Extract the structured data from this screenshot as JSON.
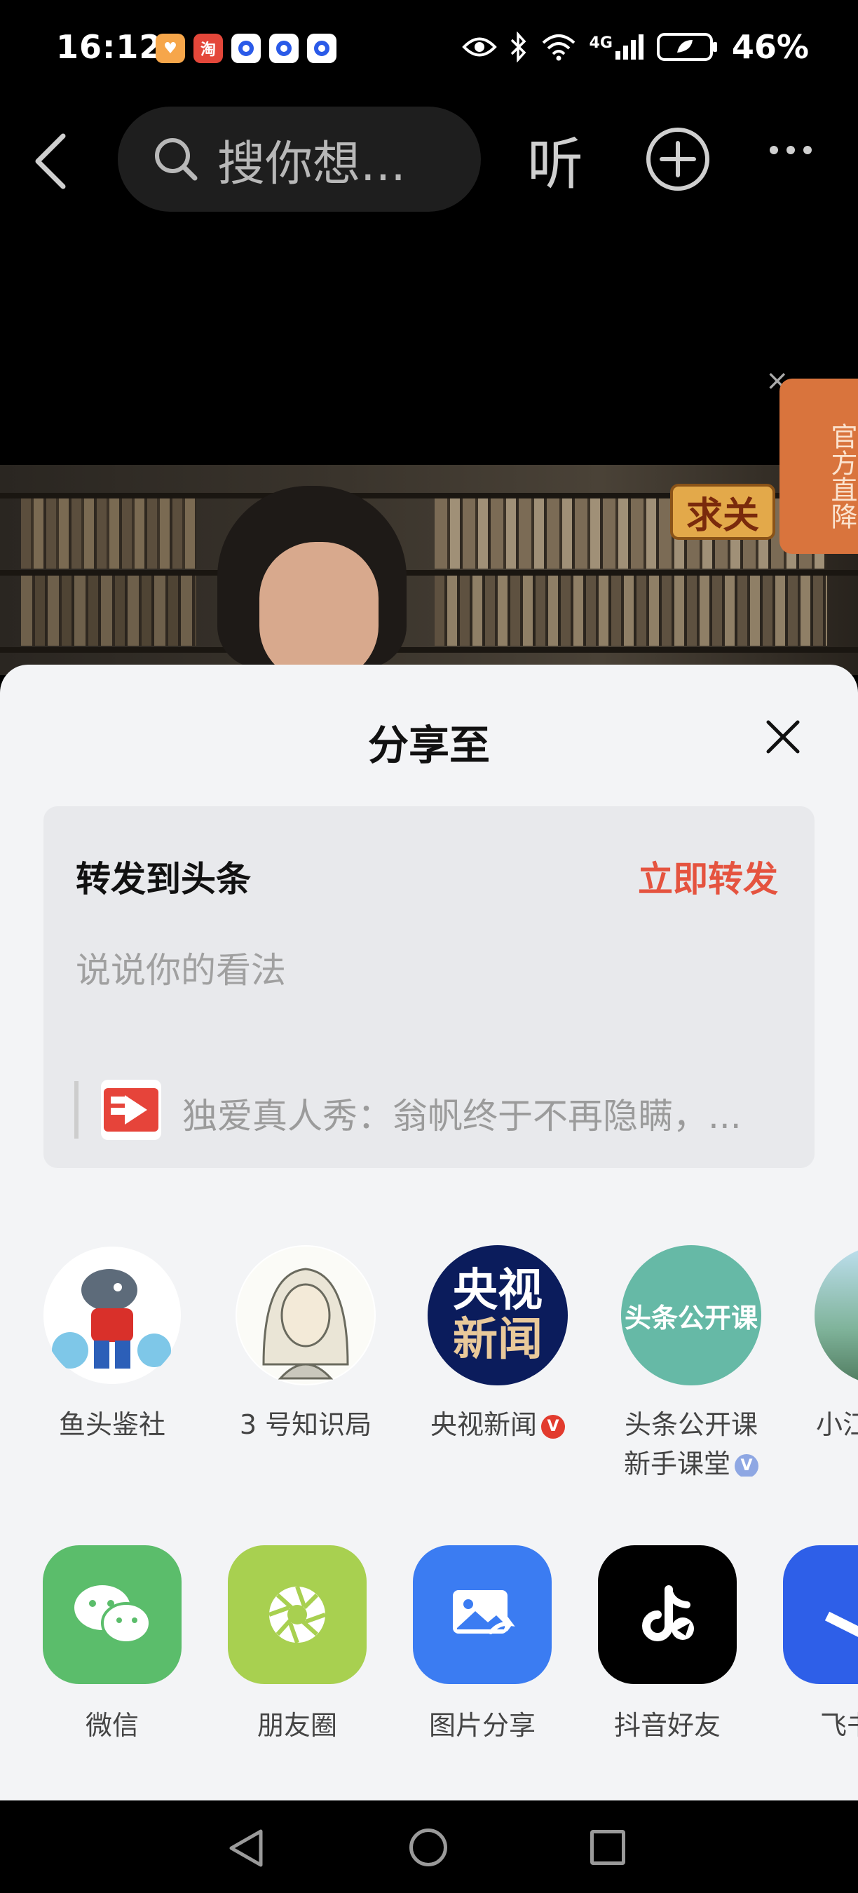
{
  "status_bar": {
    "time": "16:12",
    "network": "4G",
    "battery": "46%"
  },
  "top_nav": {
    "search_placeholder": "搜你想...",
    "listen_label": "听"
  },
  "promo": {
    "tag_text": "官方直降",
    "follow_sign": "求关"
  },
  "share_sheet": {
    "title": "分享至",
    "repost": {
      "title": "转发到头条",
      "action": "立即转发",
      "input_placeholder": "说说你的看法",
      "quote_text": "独爱真人秀：翁帆终于不再隐瞒，..."
    },
    "contacts": [
      {
        "name": "鱼头鉴社"
      },
      {
        "name": "3 号知识局"
      },
      {
        "name": "央视新闻",
        "avatar_text_1": "央视",
        "avatar_text_2": "新闻"
      },
      {
        "name_line1": "头条公开课",
        "name_line2": "新手课堂",
        "avatar_text": "头条公开课"
      },
      {
        "name": "小江"
      }
    ],
    "apps": [
      {
        "label": "微信",
        "color": "#5bbd6b"
      },
      {
        "label": "朋友圈",
        "color": "#a8d050"
      },
      {
        "label": "图片分享",
        "color": "#3b7cf2"
      },
      {
        "label": "抖音好友",
        "color": "#000000"
      },
      {
        "label": "飞书",
        "color": "#2e5fe8"
      }
    ]
  },
  "colors": {
    "accent_red": "#e5533f",
    "sheet_bg": "#f3f4f6"
  }
}
